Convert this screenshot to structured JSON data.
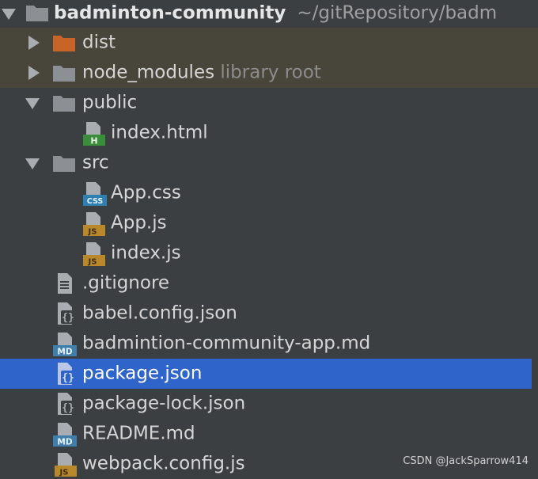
{
  "project": {
    "name": "badminton-community",
    "path": "~/gitRepository/badm"
  },
  "tree": {
    "dist": "dist",
    "node_modules": "node_modules",
    "node_modules_hint": "library root",
    "public": "public",
    "public_index": "index.html",
    "src": "src",
    "app_css": "App.css",
    "app_js": "App.js",
    "index_js": "index.js",
    "gitignore": ".gitignore",
    "babel_config": "babel.config.json",
    "app_md": "badmintion-community-app.md",
    "package_json": "package.json",
    "package_lock": "package-lock.json",
    "readme": "README.md",
    "webpack_config": "webpack.config.js"
  },
  "badges": {
    "html": "H",
    "css": "CSS",
    "js": "JS",
    "md": "MD"
  },
  "colors": {
    "panel_bg": "#3c3f41",
    "excluded_bg": "#48453b",
    "selection": "#2f65ca",
    "folder_gray": "#8c9094",
    "folder_orange": "#c86427",
    "html_badge": "#3a8e3a",
    "css_badge": "#2f7fb3",
    "js_badge": "#b8882a",
    "md_badge": "#3f7fae"
  },
  "watermark": "CSDN @JackSparrow414"
}
